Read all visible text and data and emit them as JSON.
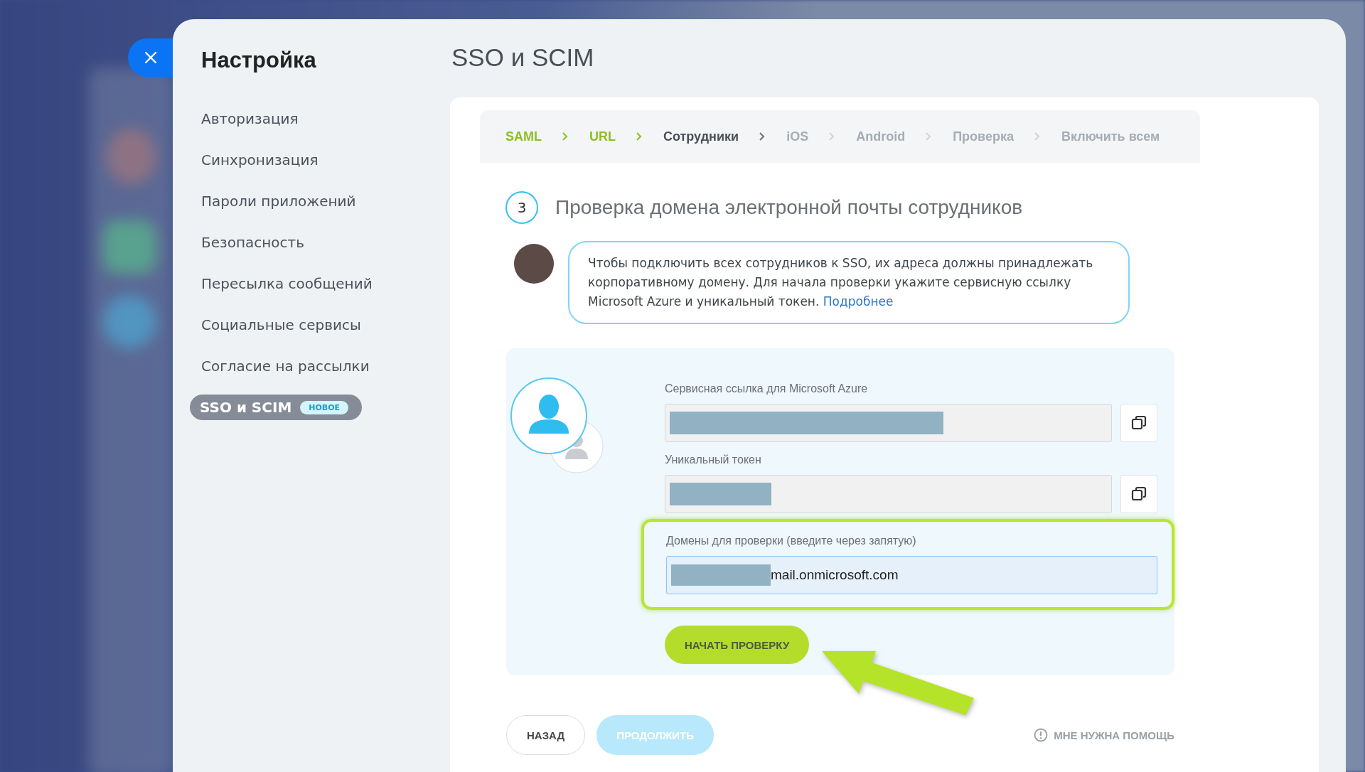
{
  "sidebar": {
    "title": "Настройка",
    "items": [
      {
        "label": "Авторизация",
        "selected": false
      },
      {
        "label": "Синхронизация",
        "selected": false
      },
      {
        "label": "Пароли приложений",
        "selected": false
      },
      {
        "label": "Безопасность",
        "selected": false
      },
      {
        "label": "Пересылка сообщений",
        "selected": false
      },
      {
        "label": "Социальные сервисы",
        "selected": false
      },
      {
        "label": "Согласие на рассылки",
        "selected": false
      },
      {
        "label": "SSO и SCIM",
        "badge": "НОВОЕ",
        "selected": true
      }
    ]
  },
  "page_title": "SSO и SCIM",
  "steps": [
    {
      "label": "SAML",
      "done": true,
      "selected": false
    },
    {
      "label": "URL",
      "done": true,
      "selected": false
    },
    {
      "label": "Сотрудники",
      "done": false,
      "selected": true
    },
    {
      "label": "iOS",
      "done": false,
      "selected": false
    },
    {
      "label": "Android",
      "done": false,
      "selected": false
    },
    {
      "label": "Проверка",
      "done": false,
      "selected": false
    },
    {
      "label": "Включить всем",
      "done": false,
      "selected": false
    }
  ],
  "section": {
    "number": "3",
    "title": "Проверка домена электронной почты сотрудников"
  },
  "hint": {
    "text": "Чтобы подключить всех сотрудников к SSO, их адреса должны принадлежать корпоративному домену. Для начала проверки укажите сервисную ссылку Microsoft Azure и уникальный токен.",
    "link": "Подробнее"
  },
  "form": {
    "fields": [
      {
        "kind": "copy",
        "label": "Сервисная ссылка для Microsoft Azure",
        "highlighted": false
      },
      {
        "kind": "copy",
        "label": "Уникальный токен",
        "highlighted": false
      },
      {
        "kind": "input",
        "label": "Домены для проверки (введите через запятую)",
        "value": "mail.onmicrosoft.com",
        "highlighted": true
      }
    ],
    "action": "НАЧАТЬ ПРОВЕРКУ"
  },
  "footer": {
    "back": "НАЗАД",
    "next": {
      "label": "ПРОДОЛЖИТЬ",
      "disabled": true
    },
    "help": "МНЕ НУЖНА ПОМОЩЬ"
  }
}
